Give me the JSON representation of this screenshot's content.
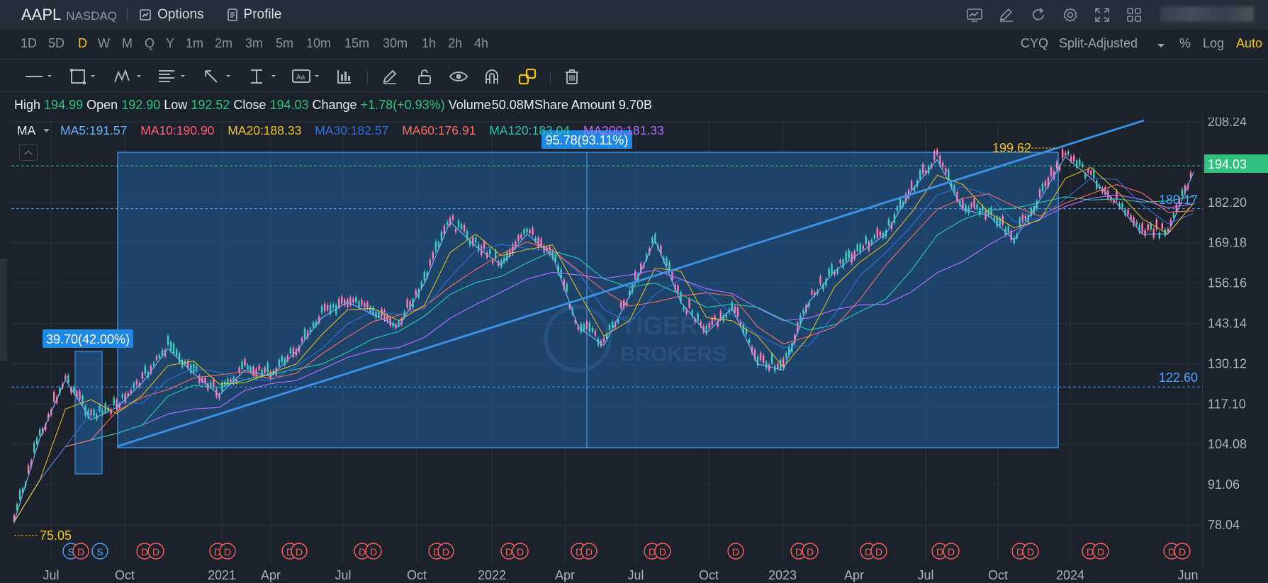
{
  "header": {
    "symbol": "AAPL",
    "exchange": "NASDAQ",
    "options_label": "Options",
    "profile_label": "Profile",
    "tool_icons": [
      "chart-icon",
      "edit-icon",
      "refresh-icon",
      "settings-icon",
      "fullscreen-icon",
      "layout-grid-icon"
    ]
  },
  "intervals": [
    "1D",
    "5D",
    "D",
    "W",
    "M",
    "Q",
    "Y",
    "1m",
    "2m",
    "3m",
    "5m",
    "10m",
    "15m",
    "30m",
    "1h",
    "2h",
    "4h"
  ],
  "active_interval": "D",
  "right_controls": {
    "cyq": "CYQ",
    "adjust": "Split-Adjusted",
    "percent": "%",
    "log": "Log",
    "auto": "Auto"
  },
  "draw_tools": [
    "line-tool-icon",
    "rectangle-tool-icon",
    "pattern-tool-icon",
    "fib-tool-icon",
    "arrow-tool-icon",
    "measure-tool-icon",
    "text-tool-icon",
    "indicator-icon",
    "pen-icon",
    "lock-icon",
    "eye-icon",
    "magnet-icon",
    "link-icon",
    "trash-icon"
  ],
  "quote": {
    "high_label": "High",
    "high": "194.99",
    "open_label": "Open",
    "open": "192.90",
    "low_label": "Low",
    "low": "192.52",
    "close_label": "Close",
    "close": "194.03",
    "change_label": "Change",
    "change": "+1.78(+0.93%)",
    "volume_label": "Volume",
    "volume": "50.08M",
    "amount_label": "Share Amount",
    "amount": "9.70B"
  },
  "ma": {
    "label": "MA",
    "items": [
      {
        "text": "MA5:191.57",
        "color": "#5fb3ff"
      },
      {
        "text": "MA10:190.90",
        "color": "#ff5e7a"
      },
      {
        "text": "MA20:188.33",
        "color": "#f0c419"
      },
      {
        "text": "MA30:182.57",
        "color": "#2f6fd6"
      },
      {
        "text": "MA60:176.91",
        "color": "#ff6b5e"
      },
      {
        "text": "MA120:183.04",
        "color": "#25c4a6"
      },
      {
        "text": "MA200:181.33",
        "color": "#b06bff"
      }
    ]
  },
  "chart_data": {
    "type": "line",
    "title": "AAPL",
    "price_axis": [
      "208.24",
      "194.03",
      "182.20",
      "169.18",
      "156.16",
      "143.14",
      "130.12",
      "117.10",
      "104.08",
      "91.06",
      "78.04"
    ],
    "current_price": "194.03",
    "x_axis": [
      "Jul",
      "Oct",
      "2021",
      "Apr",
      "Jul",
      "Oct",
      "2022",
      "Apr",
      "Jul",
      "Oct",
      "2023",
      "Apr",
      "Jul",
      "Oct",
      "2024",
      "Jun"
    ],
    "series": [
      {
        "name": "AAPL",
        "x": [
          "2020-07",
          "2020-08",
          "2020-09",
          "2020-10",
          "2020-11",
          "2020-12",
          "2021-01",
          "2021-02",
          "2021-03",
          "2021-04",
          "2021-05",
          "2021-06",
          "2021-07",
          "2021-08",
          "2021-09",
          "2021-10",
          "2021-11",
          "2021-12",
          "2022-01",
          "2022-02",
          "2022-03",
          "2022-04",
          "2022-05",
          "2022-06",
          "2022-07",
          "2022-08",
          "2022-09",
          "2022-10",
          "2022-11",
          "2022-12",
          "2023-01",
          "2023-02",
          "2023-03",
          "2023-04",
          "2023-05",
          "2023-06",
          "2023-07",
          "2023-08",
          "2023-09",
          "2023-10",
          "2023-11",
          "2023-12",
          "2024-01",
          "2024-02",
          "2024-03",
          "2024-04",
          "2024-05"
        ],
        "y": [
          79,
          106,
          125,
          112,
          116,
          124,
          135,
          127,
          120,
          128,
          126,
          134,
          145,
          150,
          146,
          142,
          156,
          176,
          168,
          162,
          172,
          165,
          142,
          136,
          152,
          170,
          150,
          140,
          148,
          130,
          128,
          150,
          160,
          166,
          172,
          186,
          196,
          180,
          178,
          170,
          183,
          197,
          190,
          182,
          172,
          172,
          192
        ]
      }
    ],
    "annotations": {
      "range_top": "199.62",
      "range_bottom": "75.05",
      "box1_label": "39.70(42.00%)",
      "box2_label": "95.78(93.11%)",
      "level_1": "180.17",
      "level_2": "122.60"
    },
    "grid": true
  }
}
